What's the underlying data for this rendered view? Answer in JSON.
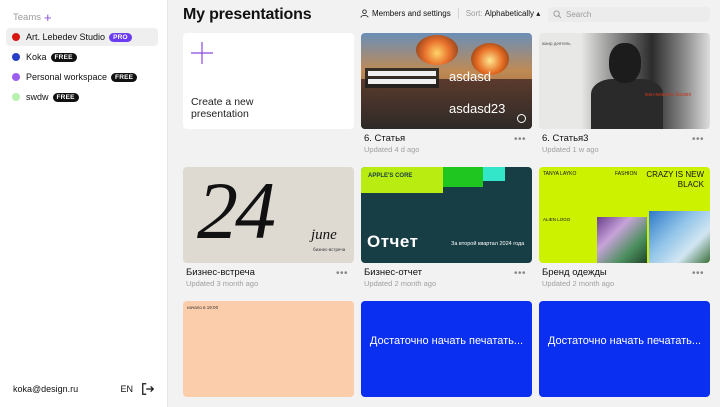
{
  "sidebar": {
    "teams_label": "Teams",
    "teams_add": "+",
    "teams": [
      {
        "name": "Art. Lebedev Studio",
        "badge": "PRO",
        "color": "#d7160f"
      },
      {
        "name": "Koka",
        "badge": "FREE",
        "color": "#2a3fc8"
      },
      {
        "name": "Personal workspace",
        "badge": "FREE",
        "color": "#9a5ef0"
      },
      {
        "name": "swdw",
        "badge": "FREE",
        "color": "#b8f0b0"
      }
    ],
    "email": "koka@design.ru",
    "lang": "EN"
  },
  "header": {
    "title": "My presentations",
    "members_label": "Members and settings",
    "sort_label": "Sort:",
    "sort_value": "Alphabetically ▴",
    "search_placeholder": "Search"
  },
  "new_presentation": {
    "label": "Create a new presentation"
  },
  "presentations": [
    {
      "title": "6. Статья",
      "updated": "Updated 4 d ago",
      "thumb": {
        "text1": "asdasd",
        "text2": "asdasd23"
      }
    },
    {
      "title": "6. Статья3",
      "updated": "Updated 1 w ago",
      "thumb": {
        "small": "жанр деятель",
        "label": "жан-мишель баския"
      }
    },
    {
      "title": "Бизнес-встреча",
      "updated": "Updated 3 month ago",
      "thumb": {
        "number": "24",
        "month": "june",
        "small": "бизнес-встреча"
      }
    },
    {
      "title": "Бизнес-отчет",
      "updated": "Updated 2 month ago",
      "thumb": {
        "core": "APPLE'S CORE",
        "heading": "Отчет",
        "quarter": "За второй квартал 2024 года"
      }
    },
    {
      "title": "Бренд одежды",
      "updated": "Updated 2 month ago",
      "thumb": {
        "name": "TANYA LAYKO",
        "fashion": "FASHION",
        "headline": "CRAZY IS NEW BLACK",
        "logo": "ALIEN LOGO"
      }
    },
    {
      "title": "",
      "updated": "",
      "thumb": {
        "small": "начало в 19:00"
      }
    },
    {
      "title": "",
      "updated": "",
      "thumb": {
        "message": "Достаточно начать печатать..."
      }
    },
    {
      "title": "",
      "updated": "",
      "thumb": {
        "message": "Достаточно начать печатать..."
      }
    }
  ],
  "more_label": "•••",
  "colors": {
    "accent": "#8a4bdc",
    "pro_badge": "#6b3cf2"
  }
}
